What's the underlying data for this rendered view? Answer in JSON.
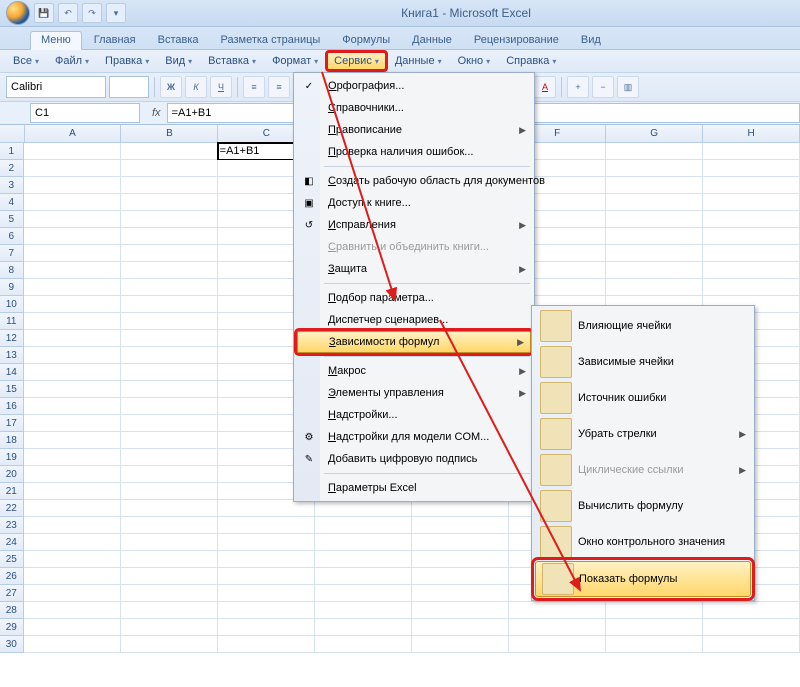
{
  "title": "Книга1 - Microsoft Excel",
  "tabs": [
    "Меню",
    "Главная",
    "Вставка",
    "Разметка страницы",
    "Формулы",
    "Данные",
    "Рецензирование",
    "Вид"
  ],
  "active_tab": 0,
  "menubar": [
    "Все",
    "Файл",
    "Правка",
    "Вид",
    "Вставка",
    "Формат",
    "Сервис",
    "Данные",
    "Окно",
    "Справка"
  ],
  "open_menu_index": 6,
  "font": {
    "name": "Calibri",
    "size": ""
  },
  "namebox": "C1",
  "formula": "=A1+B1",
  "columns": [
    "A",
    "B",
    "C",
    "D",
    "E",
    "F",
    "G",
    "H"
  ],
  "rows": 30,
  "cell_c1": "=A1+B1",
  "menu_service": [
    {
      "icon": "✓",
      "label": "Орфография...",
      "u": 0
    },
    {
      "label": "Справочники...",
      "u": 0
    },
    {
      "label": "Правописание",
      "u": 0,
      "arr": true
    },
    {
      "label": "Проверка наличия ошибок...",
      "u": 0
    },
    {
      "sep": true
    },
    {
      "icon": "◧",
      "label": "Создать рабочую область для документов",
      "u": 0
    },
    {
      "icon": "▣",
      "label": "Доступ к книге...",
      "u": 0
    },
    {
      "icon": "↺",
      "label": "Исправления",
      "u": 0,
      "arr": true
    },
    {
      "label": "Сравнить и объединить книги...",
      "u": 0,
      "dis": true
    },
    {
      "label": "Защита",
      "u": 0,
      "arr": true
    },
    {
      "sep": true
    },
    {
      "label": "Подбор параметра...",
      "u": 0
    },
    {
      "label": "Диспетчер сценариев...",
      "u": 0
    },
    {
      "label": "Зависимости формул",
      "u": 0,
      "arr": true,
      "hi": true
    },
    {
      "sep": true
    },
    {
      "label": "Макрос",
      "u": 0,
      "arr": true
    },
    {
      "label": "Элементы управления",
      "u": 0,
      "arr": true
    },
    {
      "label": "Надстройки...",
      "u": 0
    },
    {
      "icon": "⚙",
      "label": "Надстройки для модели COM...",
      "u": 0
    },
    {
      "icon": "✎",
      "label": "Добавить цифровую подпись",
      "u": 0
    },
    {
      "sep": true
    },
    {
      "label": "Параметры Excel",
      "u": 0
    }
  ],
  "submenu_formulas": [
    {
      "label": "Влияющие ячейки"
    },
    {
      "label": "Зависимые ячейки"
    },
    {
      "label": "Источник ошибки"
    },
    {
      "label": "Убрать стрелки",
      "arr": true
    },
    {
      "label": "Циклические ссылки",
      "arr": true,
      "dis": true
    },
    {
      "label": "Вычислить формулу"
    },
    {
      "label": "Окно контрольного значения"
    },
    {
      "label": "Показать формулы",
      "hi": true
    }
  ]
}
